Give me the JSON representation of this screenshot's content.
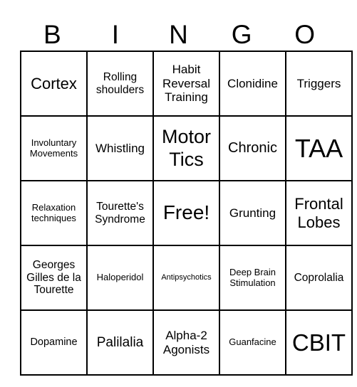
{
  "card": {
    "header": [
      "B",
      "I",
      "N",
      "G",
      "O"
    ],
    "rows": [
      [
        "Cortex",
        "Rolling shoulders",
        "Habit Reversal Training",
        "Clonidine",
        "Triggers"
      ],
      [
        "Involuntary Movements",
        "Whistling",
        "Motor Tics",
        "Chronic",
        "TAA"
      ],
      [
        "Relaxation techniques",
        "Tourette's Syndrome",
        "Free!",
        "Grunting",
        "Frontal Lobes"
      ],
      [
        "Georges Gilles de la Tourette",
        "Haloperidol",
        "Antipsychotics",
        "Deep Brain Stimulation",
        "Coprolalia"
      ],
      [
        "Dopamine",
        "Palilalia",
        "Alpha-2 Agonists",
        "Guanfacine",
        "CBIT"
      ]
    ]
  }
}
